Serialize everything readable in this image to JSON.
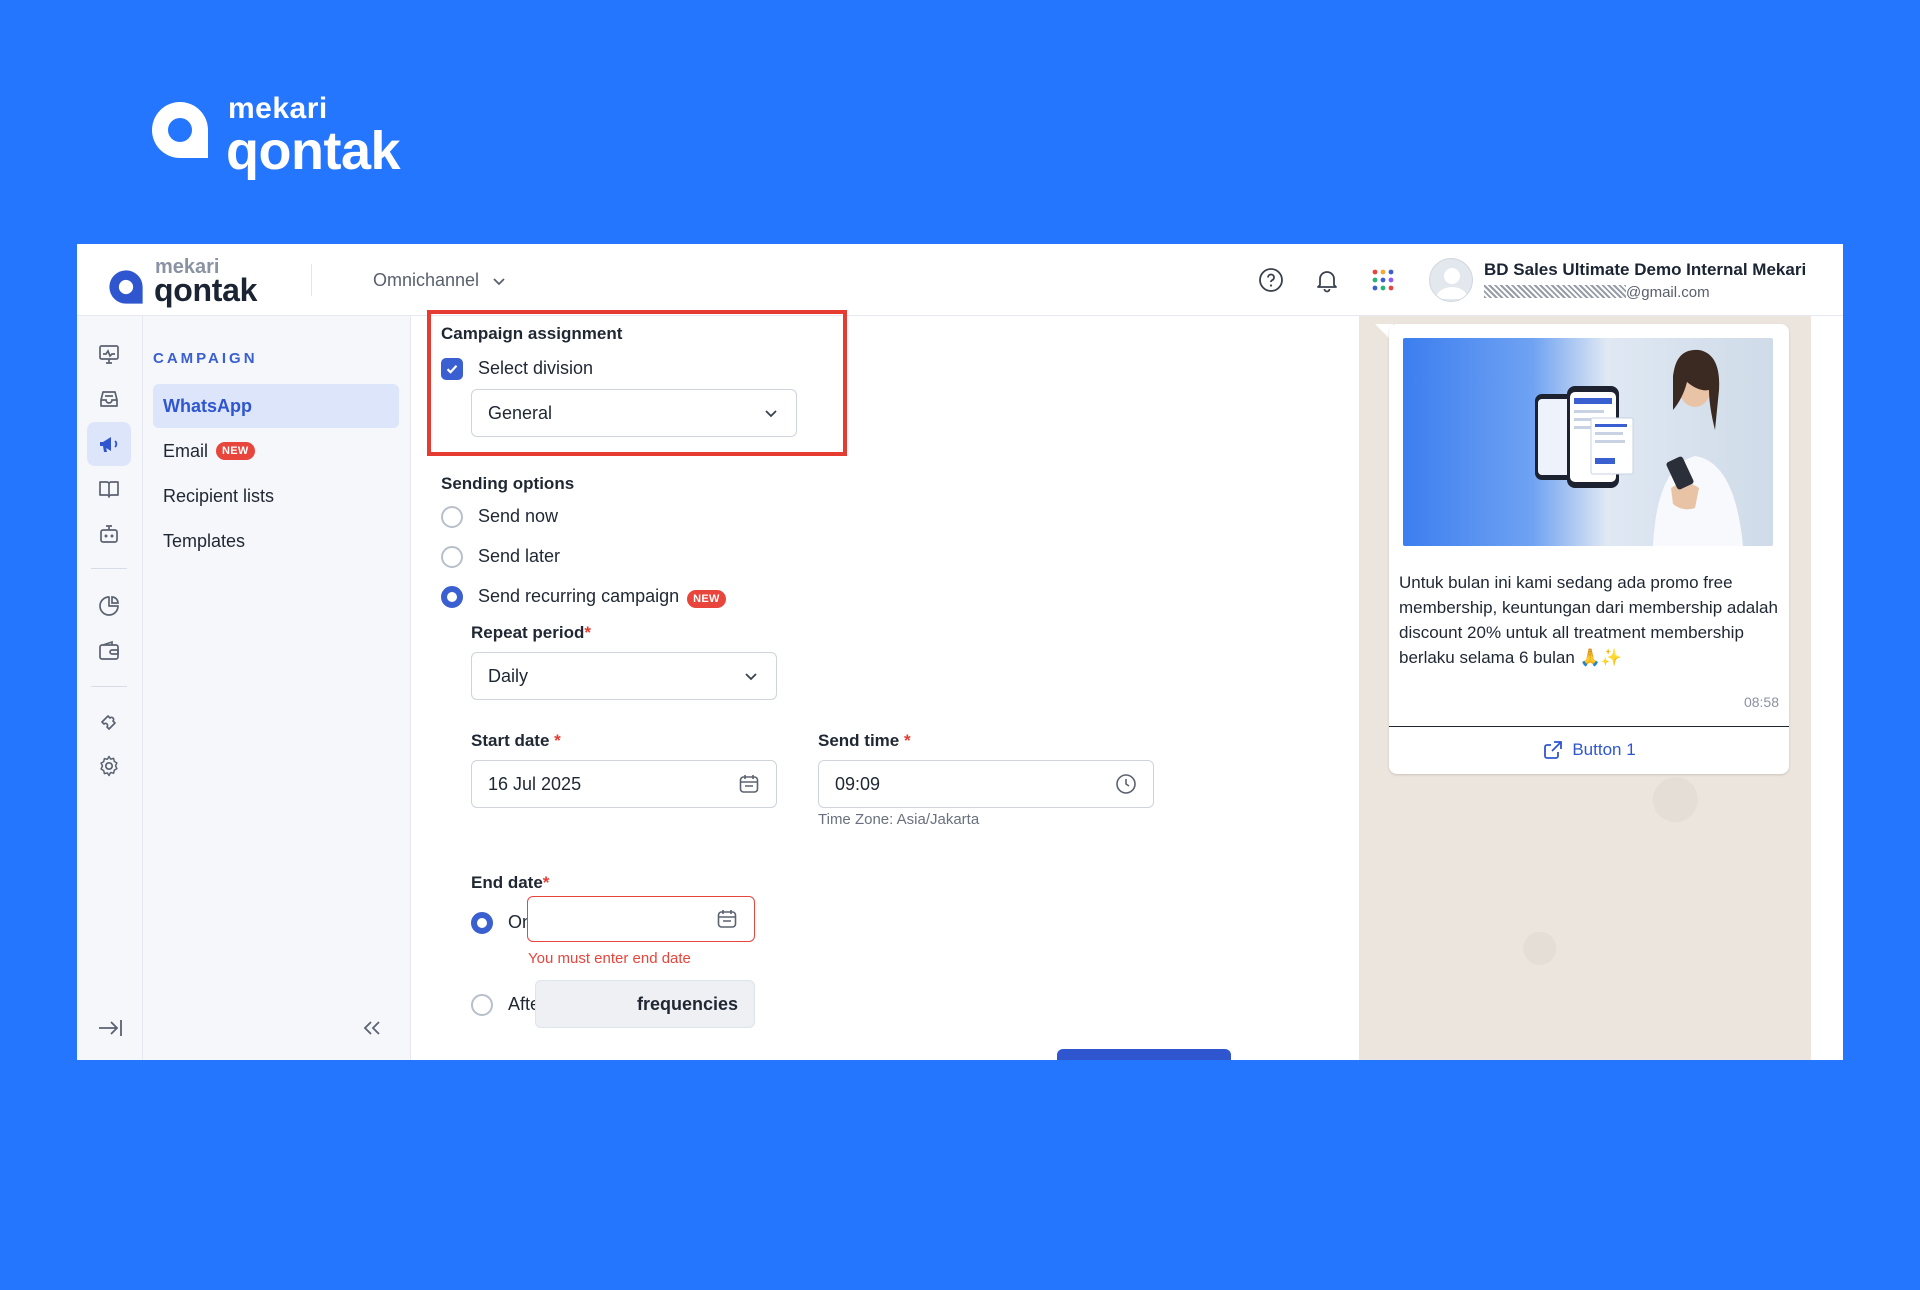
{
  "hero": {
    "brand_top": "mekari",
    "brand_main": "qontak"
  },
  "topbar": {
    "brand_top": "mekari",
    "brand_main": "qontak",
    "product": "Omnichannel",
    "user_name": "BD Sales Ultimate Demo Internal Mekari",
    "user_email_suffix": "@gmail.com"
  },
  "subnav": {
    "title": "CAMPAIGN",
    "items": [
      {
        "label": "WhatsApp",
        "active": true
      },
      {
        "label": "Email",
        "badge": "NEW"
      },
      {
        "label": "Recipient lists"
      },
      {
        "label": "Templates"
      }
    ]
  },
  "form": {
    "campaign_assignment": {
      "title": "Campaign assignment",
      "checkbox_label": "Select division",
      "division_value": "General"
    },
    "sending_options": {
      "title": "Sending options",
      "options": [
        {
          "label": "Send now",
          "selected": false
        },
        {
          "label": "Send later",
          "selected": false
        },
        {
          "label": "Send recurring campaign",
          "selected": true,
          "badge": "NEW"
        }
      ]
    },
    "repeat_period": {
      "label": "Repeat period",
      "required": "*",
      "value": "Daily"
    },
    "start_date": {
      "label": "Start date",
      "required": "*",
      "value": "16 Jul 2025"
    },
    "send_time": {
      "label": "Send time",
      "required": "*",
      "value": "09:09",
      "helper": "Time Zone: Asia/Jakarta"
    },
    "end_date": {
      "label": "End date",
      "required": "*",
      "on_label": "On",
      "error": "You must enter end date",
      "after_label": "After",
      "frequency_unit": "frequencies"
    }
  },
  "preview": {
    "message": "Untuk bulan ini kami sedang ada promo free membership, keuntungan dari membership adalah discount 20% untuk all treatment membership berlaku selama 6 bulan 🙏✨",
    "time": "08:58",
    "button_label": "Button 1"
  },
  "colors": {
    "background": "#2476FF",
    "accent": "#3A5FD0",
    "error": "#E63B30",
    "highlight_border": "#E63B30"
  }
}
